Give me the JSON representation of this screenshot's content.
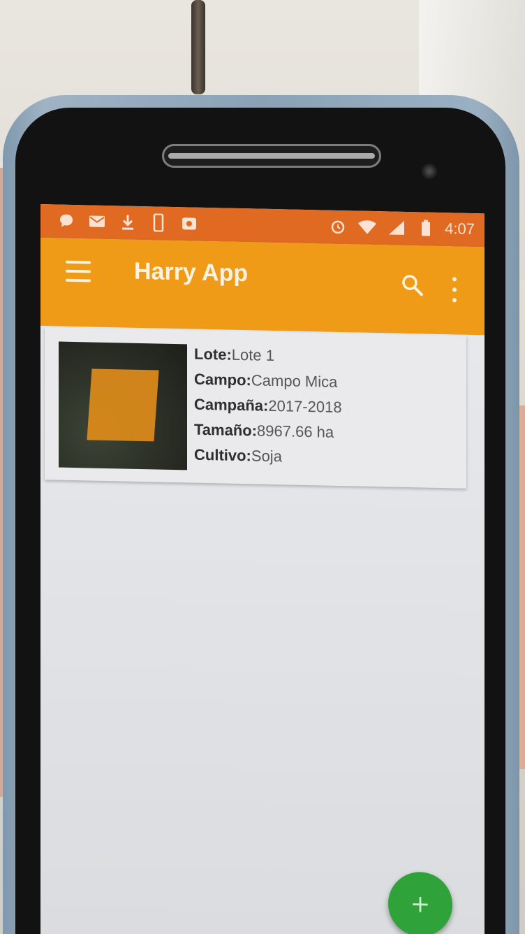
{
  "status_bar": {
    "time": "4:07",
    "left_icons": [
      "chat-bubble-icon",
      "mail-icon",
      "download-icon",
      "phone-icon",
      "photo-icon"
    ],
    "right_icons": [
      "alarm-icon",
      "wifi-icon",
      "signal-icon",
      "battery-icon"
    ],
    "color": "#e06a22"
  },
  "app_bar": {
    "title": "Harry App",
    "color": "#ef9b17",
    "menu_icon": "hamburger-menu-icon",
    "search_icon": "search-icon",
    "overflow_icon": "more-vert-icon"
  },
  "lots": [
    {
      "thumbnail": "satellite-field-thumbnail",
      "fields": [
        {
          "key": "Lote:",
          "value": "Lote 1"
        },
        {
          "key": "Campo:",
          "value": "Campo Mica"
        },
        {
          "key": "Campaña:",
          "value": "2017-2018"
        },
        {
          "key": "Tamaño:",
          "value": "8967.66 ha"
        },
        {
          "key": "Cultivo:",
          "value": "Soja"
        }
      ]
    }
  ],
  "fab": {
    "label": "+",
    "color": "#2fa33a"
  }
}
